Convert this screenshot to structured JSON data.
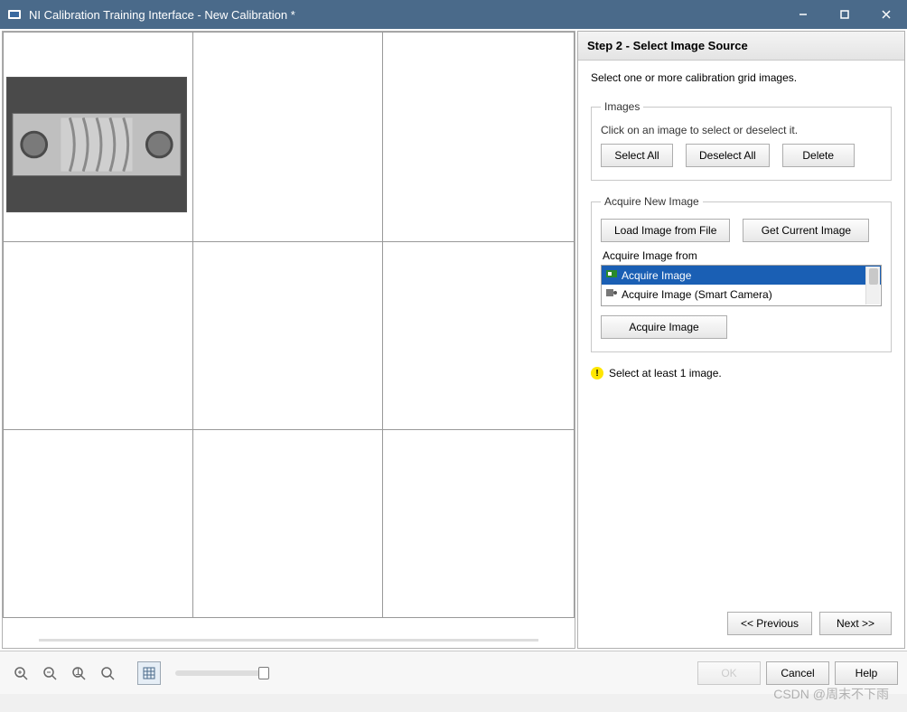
{
  "window": {
    "title": "NI Calibration Training Interface - New Calibration *"
  },
  "step": {
    "header": "Step 2 - Select Image Source",
    "description": "Select one or more calibration grid images."
  },
  "images_group": {
    "legend": "Images",
    "hint": "Click on an image to select or deselect it.",
    "select_all": "Select All",
    "deselect_all": "Deselect All",
    "delete": "Delete"
  },
  "acquire_group": {
    "legend": "Acquire New Image",
    "load_from_file": "Load Image from File",
    "get_current": "Get Current Image",
    "from_label": "Acquire Image from",
    "options": [
      {
        "label": "Acquire Image",
        "selected": true
      },
      {
        "label": "Acquire Image (Smart Camera)",
        "selected": false
      }
    ],
    "acquire_btn": "Acquire Image"
  },
  "warning": "Select at least 1 image.",
  "nav": {
    "previous": "<< Previous",
    "next": "Next >>"
  },
  "footer": {
    "ok": "OK",
    "cancel": "Cancel",
    "help": "Help"
  },
  "watermark": "CSDN @周末不下雨"
}
